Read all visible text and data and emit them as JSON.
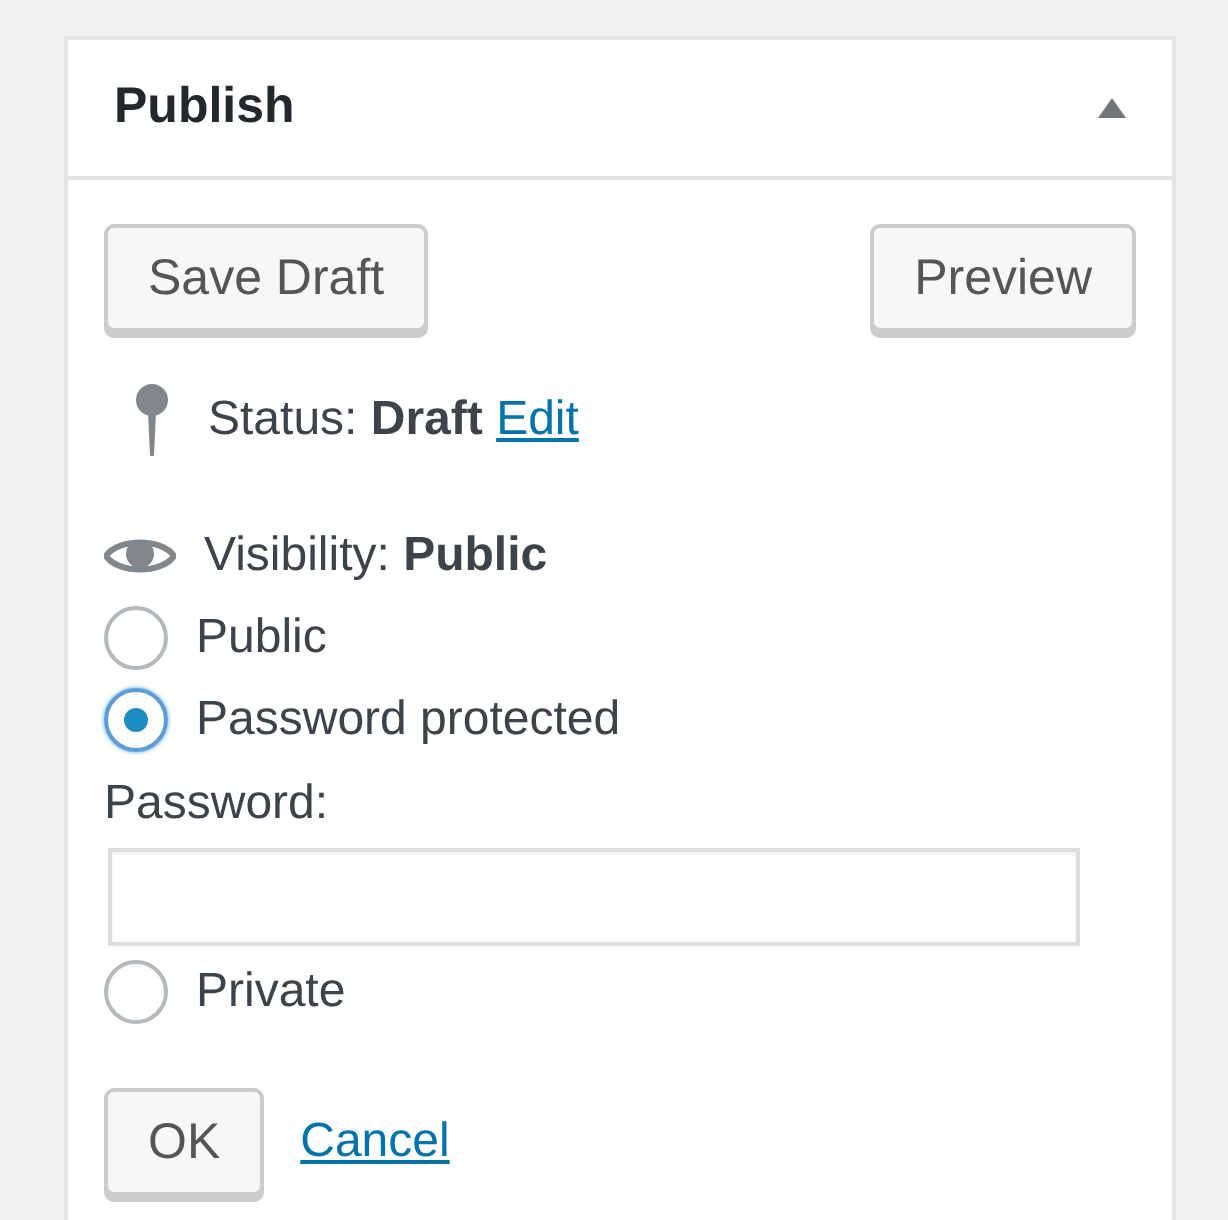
{
  "panel": {
    "title": "Publish",
    "expanded": true
  },
  "actions": [
    {
      "label": "Save Draft"
    },
    {
      "label": "Preview"
    }
  ],
  "status": {
    "label": "Status:",
    "value": "Draft",
    "link": "Edit"
  },
  "visibility": {
    "label": "Visibility:",
    "value": "Public"
  },
  "options": [
    {
      "label": "Public",
      "selected": false
    },
    {
      "label": "Password protected",
      "selected": true,
      "field": {
        "label": "Password:"
      }
    },
    {
      "label": "Private",
      "selected": false
    }
  ],
  "confirm": {
    "ok": "OK",
    "cancel": "Cancel"
  }
}
